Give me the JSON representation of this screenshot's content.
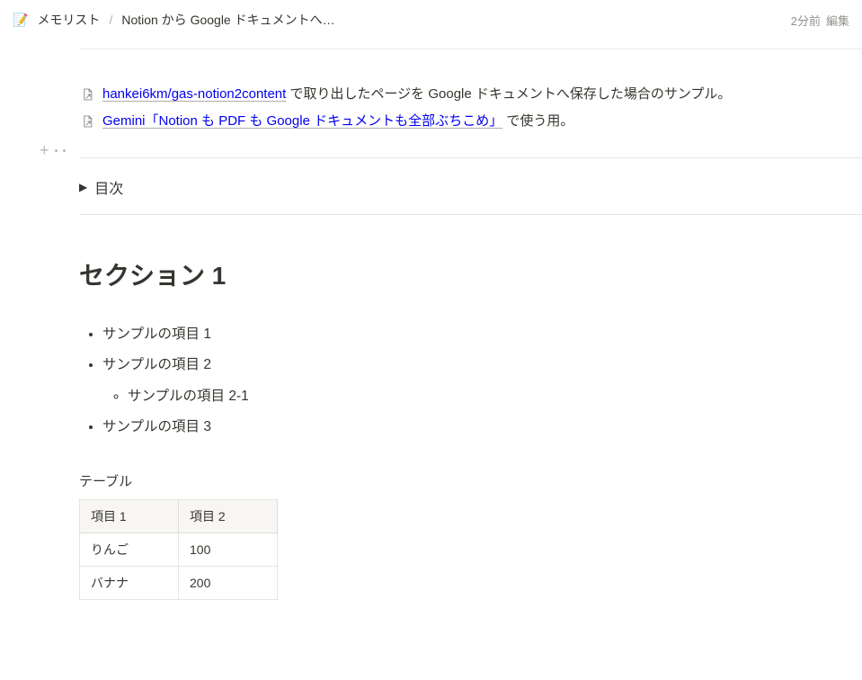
{
  "breadcrumb": {
    "icon": "📝",
    "parent": "メモリスト",
    "current": "Notion から Google ドキュメントへ…"
  },
  "meta": {
    "time": "2分前",
    "edited": "編集"
  },
  "links": {
    "l1_link": "hankei6km/gas-notion2content",
    "l1_rest": " で取り出したページを Google ドキュメントへ保存した場合のサンプル。",
    "l2_link": "Gemini「Notion も PDF も Google ドキュメントも全部ぶちこめ」",
    "l2_rest": " で使う用。"
  },
  "toc_label": "目次",
  "section1_title": "セクション 1",
  "bullets": {
    "i0": "サンプルの項目 1",
    "i1": "サンプルの項目 2",
    "i1_0": "サンプルの項目 2-1",
    "i2": "サンプルの項目 3"
  },
  "table_caption": "テーブル",
  "table": {
    "h0": "項目 1",
    "h1": "項目 2",
    "r0c0": "りんご",
    "r0c1": "100",
    "r1c0": "バナナ",
    "r1c1": "200"
  }
}
